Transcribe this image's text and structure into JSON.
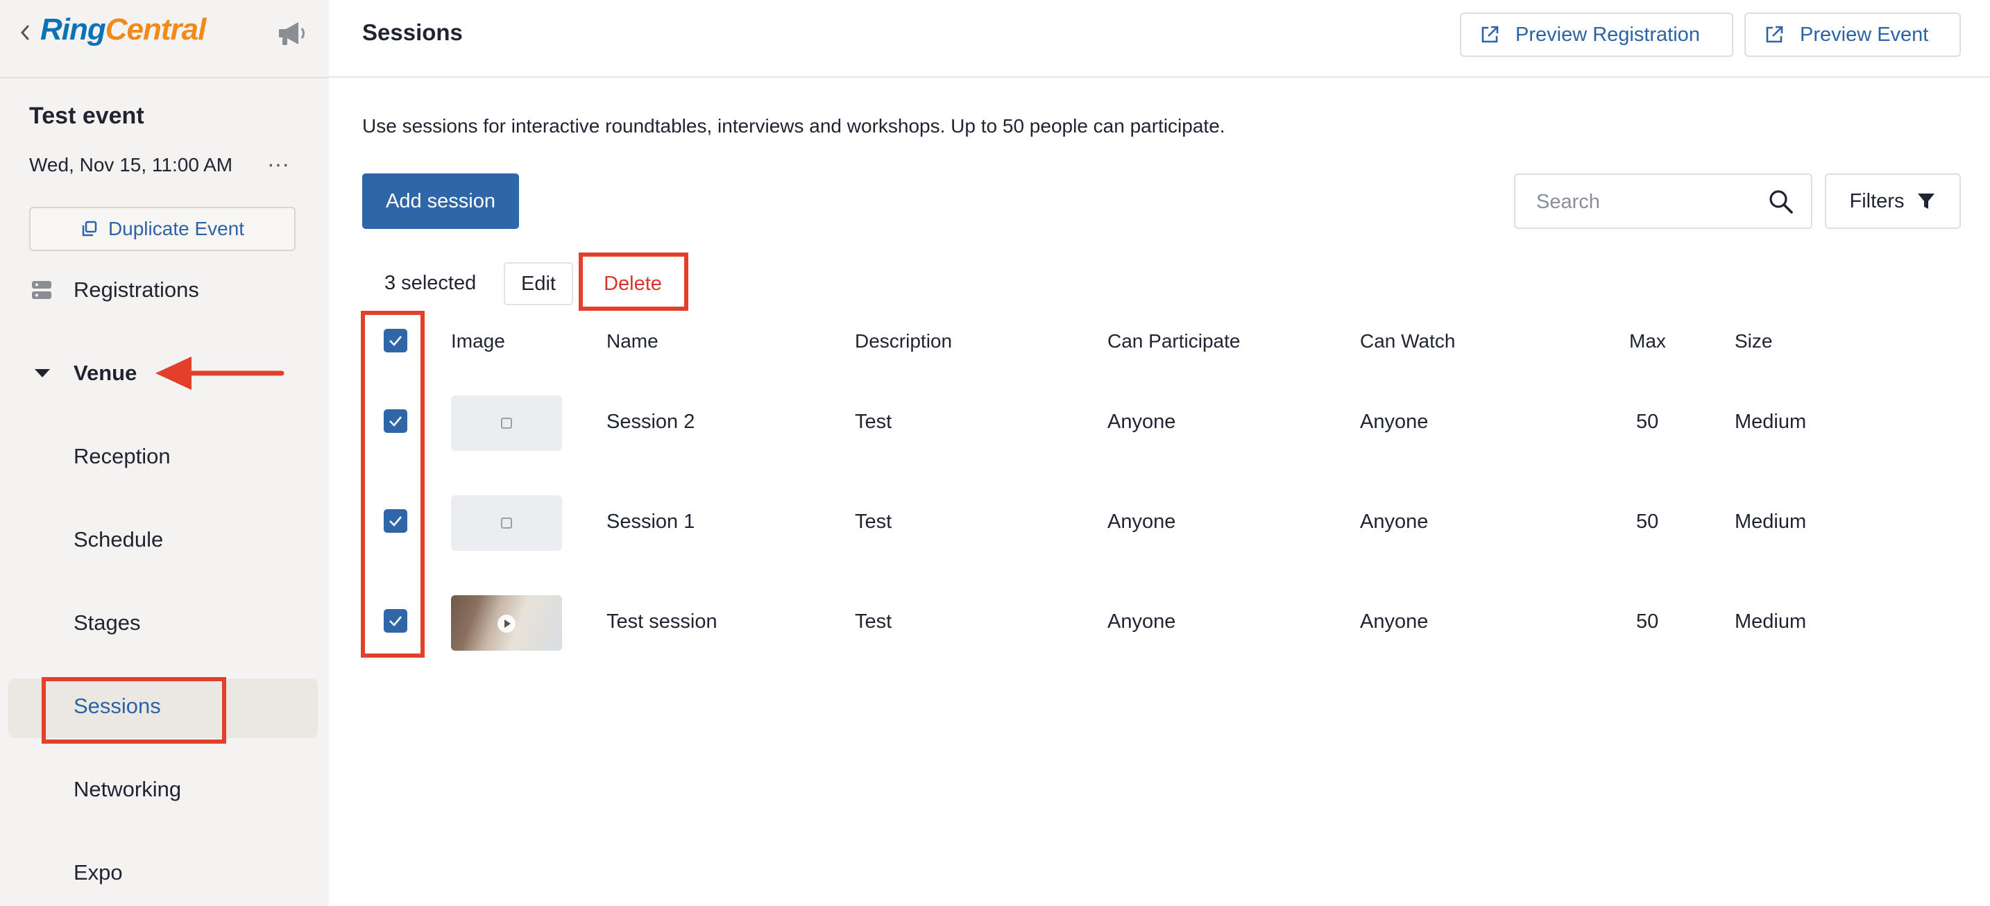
{
  "sidebar": {
    "logo_ring": "Ring",
    "logo_central": "Central",
    "event_title": "Test event",
    "event_date": "Wed, Nov 15, 11:00 AM",
    "more_label": "···",
    "duplicate_label": "Duplicate Event",
    "items": [
      {
        "label": "Registrations",
        "icon": "registrations-icon"
      },
      {
        "label": "Venue",
        "icon": "caret-down-icon",
        "expanded": true
      },
      {
        "label": "Reception"
      },
      {
        "label": "Schedule"
      },
      {
        "label": "Stages"
      },
      {
        "label": "Sessions",
        "active": true
      },
      {
        "label": "Networking"
      },
      {
        "label": "Expo"
      }
    ]
  },
  "header": {
    "title": "Sessions",
    "preview_registration": "Preview Registration",
    "preview_event": "Preview Event"
  },
  "main": {
    "intro": "Use sessions for interactive roundtables, interviews and workshops. Up to 50 people can participate.",
    "add_session": "Add session",
    "search_placeholder": "Search",
    "filters": "Filters",
    "selected_count": "3 selected",
    "edit": "Edit",
    "delete": "Delete"
  },
  "table": {
    "headers": [
      "Image",
      "Name",
      "Description",
      "Can Participate",
      "Can Watch",
      "Max",
      "Size"
    ],
    "rows": [
      {
        "name": "Session 2",
        "description": "Test",
        "can_participate": "Anyone",
        "can_watch": "Anyone",
        "max": "50",
        "size": "Medium",
        "checked": true,
        "image": "placeholder"
      },
      {
        "name": "Session 1",
        "description": "Test",
        "can_participate": "Anyone",
        "can_watch": "Anyone",
        "max": "50",
        "size": "Medium",
        "checked": true,
        "image": "placeholder"
      },
      {
        "name": "Test session",
        "description": "Test",
        "can_participate": "Anyone",
        "can_watch": "Anyone",
        "max": "50",
        "size": "Medium",
        "checked": true,
        "image": "photo-video"
      }
    ]
  },
  "colors": {
    "brand_blue": "#2e66a8",
    "link_blue": "#2c63a5",
    "annotation_red": "#e2402a",
    "delete_red": "#d9352a",
    "sidebar_bg": "#f4f3f1"
  }
}
